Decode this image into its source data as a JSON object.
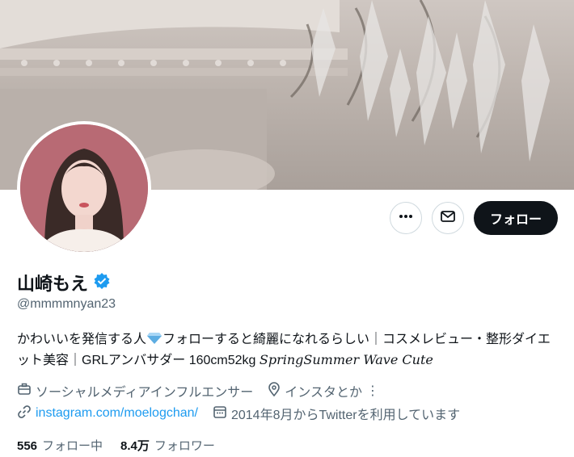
{
  "profile": {
    "name": "山崎もえ",
    "handle": "@mmmmnyan23",
    "bio_part1": "かわいいを発信する人",
    "bio_part2": "フォローすると綺麗になれるらしい｜コスメレビュー・整形ダイエット美容｜GRLアンバサダー 160cm52kg ",
    "bio_script": "SpringSummer Wave Cute",
    "category": "ソーシャルメディアインフルエンサー",
    "location": "インスタとか",
    "location_suffix": "⋮",
    "website": "instagram.com/moelogchan/",
    "joined": "2014年8月からTwitterを利用しています"
  },
  "actions": {
    "follow_label": "フォロー"
  },
  "stats": {
    "following_count": "556",
    "following_label": "フォロー中",
    "followers_count": "8.4万",
    "followers_label": "フォロワー"
  },
  "icons": [
    "more-icon",
    "mail-icon",
    "verified-icon",
    "diamond-icon",
    "briefcase-icon",
    "location-icon",
    "link-icon",
    "calendar-icon"
  ],
  "colors": {
    "accent": "#1d9bf0",
    "primary_text": "#0f1419",
    "secondary_text": "#536471",
    "follow_bg": "#0f1419"
  }
}
